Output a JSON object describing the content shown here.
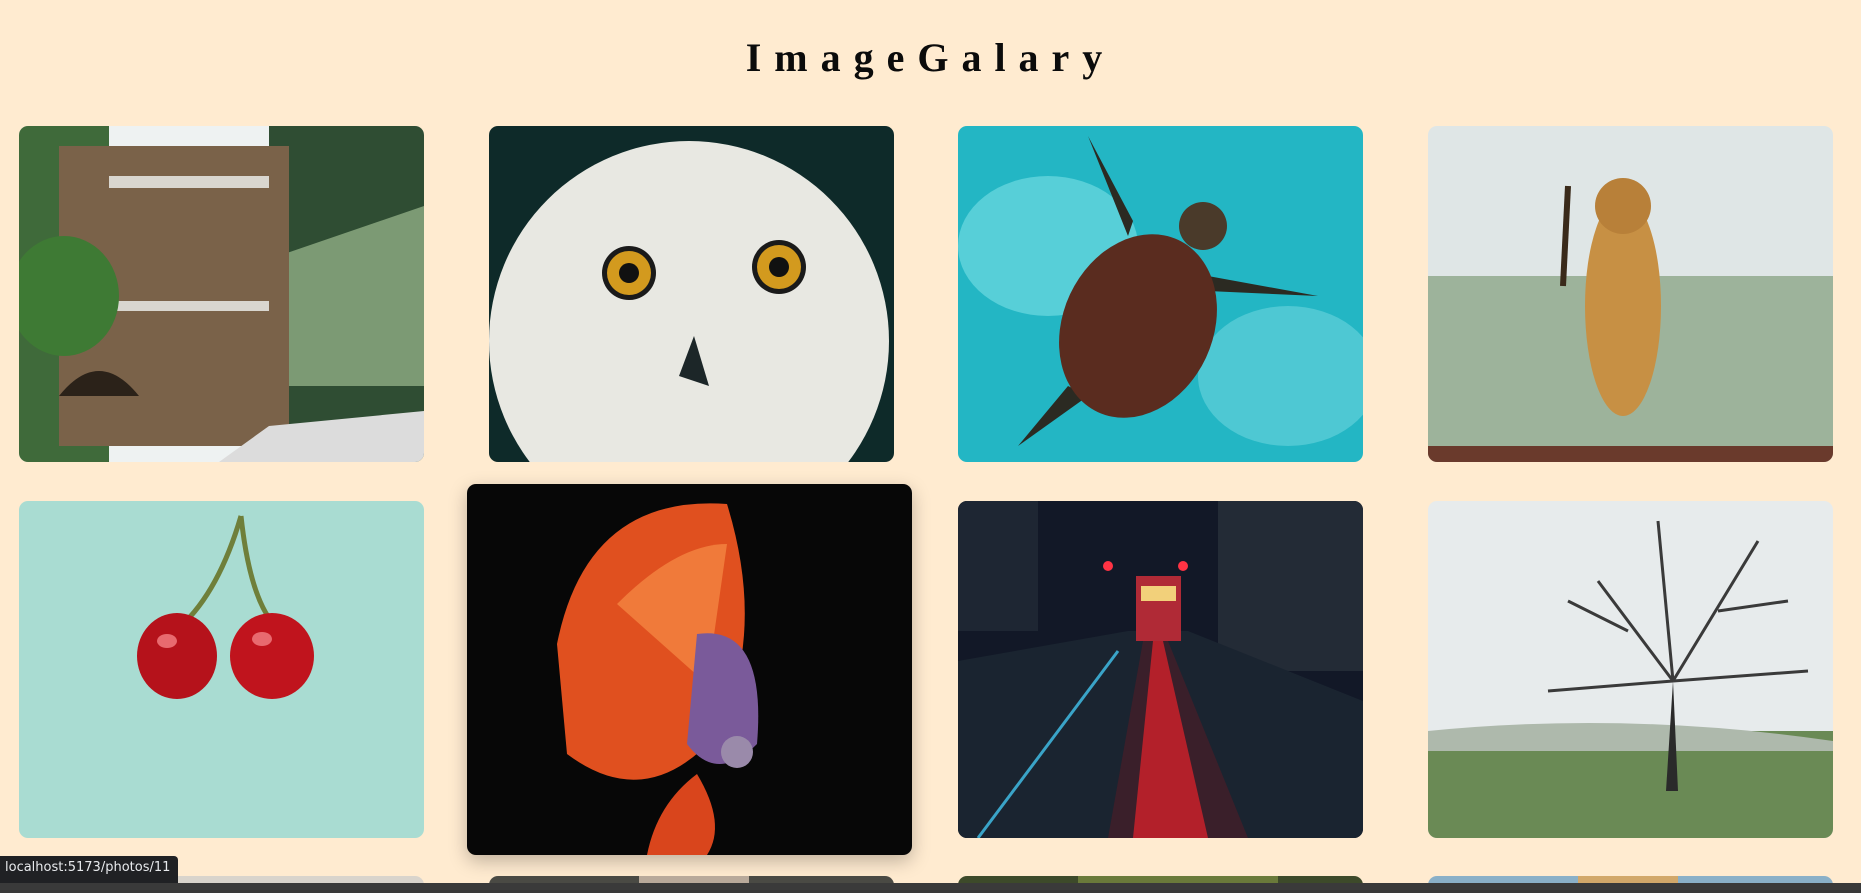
{
  "page": {
    "title": "ImageGalary",
    "background": "#ffebd0"
  },
  "status_bar": {
    "url": "localhost:5173/photos/11"
  },
  "photos": [
    {
      "id": 1,
      "subject": "stone-castle",
      "href": "/photos/1"
    },
    {
      "id": 2,
      "subject": "snowy-owl",
      "href": "/photos/2"
    },
    {
      "id": 3,
      "subject": "sea-turtle",
      "href": "/photos/3"
    },
    {
      "id": 4,
      "subject": "lioness",
      "href": "/photos/4"
    },
    {
      "id": 5,
      "subject": "cherries",
      "href": "/photos/5"
    },
    {
      "id": 6,
      "subject": "betta-fish",
      "href": "/photos/6",
      "hovered": true
    },
    {
      "id": 7,
      "subject": "city-tram-night",
      "href": "/photos/7"
    },
    {
      "id": 8,
      "subject": "foggy-tree",
      "href": "/photos/8"
    },
    {
      "id": 9,
      "subject": "partial-photo",
      "href": "/photos/9"
    },
    {
      "id": 10,
      "subject": "partial-photo",
      "href": "/photos/10"
    },
    {
      "id": 11,
      "subject": "partial-photo",
      "href": "/photos/11"
    },
    {
      "id": 12,
      "subject": "partial-photo",
      "href": "/photos/12"
    }
  ]
}
